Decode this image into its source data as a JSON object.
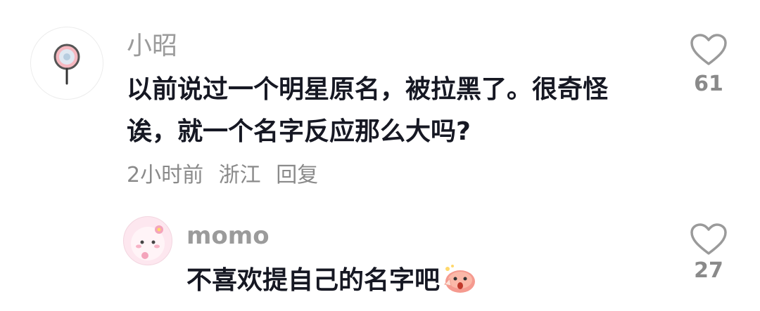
{
  "comments": [
    {
      "username": "小昭",
      "text_line1": "以前说过一个明星原名，被拉黑了。很奇怪",
      "text_line2": "诶，就一个名字反应那么大吗?",
      "time": "2小时前",
      "location": "浙江",
      "reply_label": "回复",
      "likes": "61",
      "avatar_icon": "lollipop-icon"
    },
    {
      "username": "momo",
      "text": "不喜欢提自己的名字吧",
      "likes": "27",
      "avatar_icon": "pink-cartoon-avatar",
      "emoji": "shocked-emoji"
    }
  ],
  "colors": {
    "username": "#9b9b9b",
    "text": "#161823",
    "meta": "#8a8a8a",
    "heart_outline": "#9a9a9a"
  }
}
